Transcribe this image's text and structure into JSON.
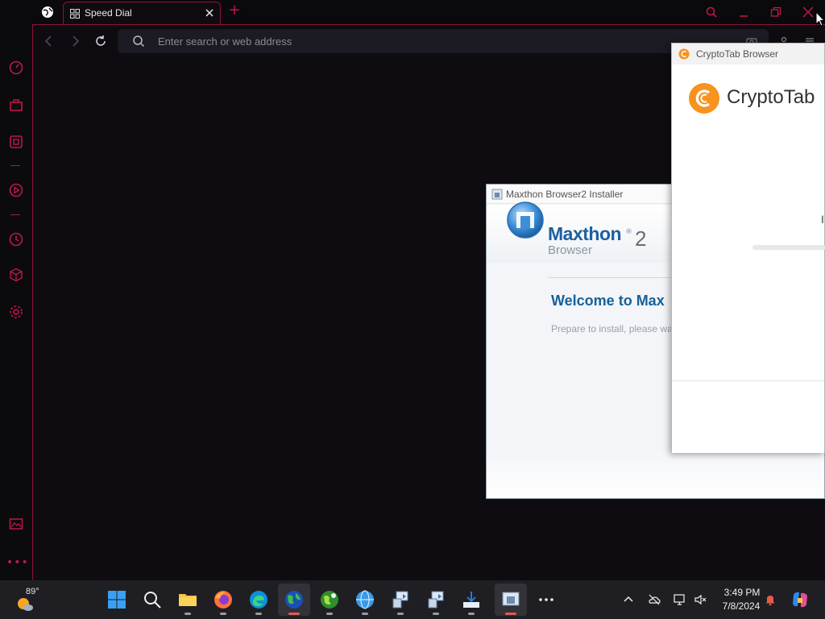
{
  "browser": {
    "tab_title": "Speed Dial",
    "address_placeholder": "Enter search or web address",
    "sidebar_icons": [
      "speed-dial-icon",
      "shopping-icon",
      "wallet-icon",
      "player-icon",
      "history-icon",
      "extensions-icon",
      "settings-icon",
      "pinboard-icon"
    ],
    "accent_color": "#c0174a"
  },
  "maxthon": {
    "window_title": "Maxthon Browser2 Installer",
    "brand": "Maxthon",
    "registered": "®",
    "version": "2",
    "subtitle": "Browser",
    "welcome": "Welcome to Max",
    "prepare": "Prepare to install, please wa"
  },
  "cryptotab": {
    "window_title": "CryptoTab Browser",
    "brand": "CryptoTab",
    "status_fragment": "I",
    "brand_color": "#f7931e"
  },
  "taskbar": {
    "weather_temp": "89°",
    "time": "3:49 PM",
    "date": "7/8/2024",
    "apps": [
      "start",
      "search",
      "file-explorer",
      "firefox",
      "edge",
      "globe-browser",
      "green-browser",
      "blue-globe-browser",
      "installer-1",
      "installer-2",
      "downloader",
      "maxthon-installer",
      "more"
    ]
  }
}
